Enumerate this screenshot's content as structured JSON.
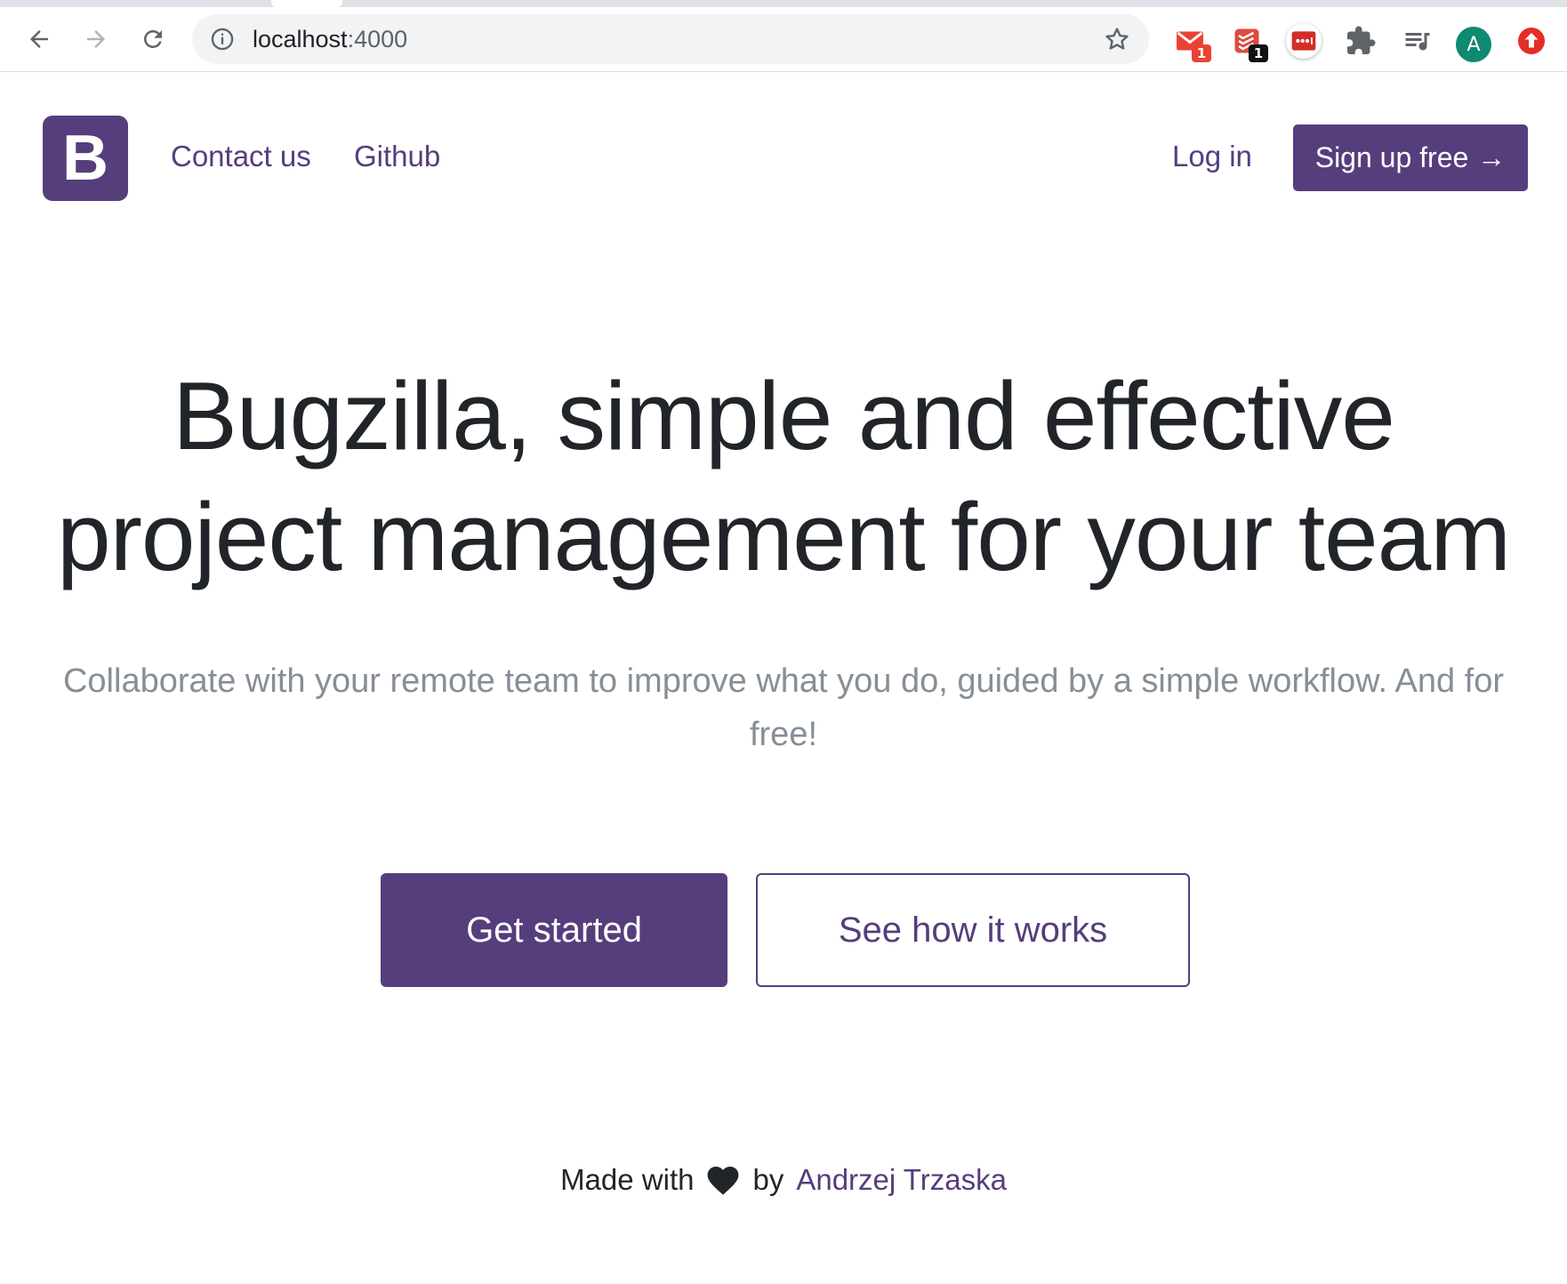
{
  "browser": {
    "url_host": "localhost",
    "url_port": ":4000",
    "extensions": [
      {
        "name": "gmail-extension-icon",
        "badge": "1"
      },
      {
        "name": "todoist-extension-icon",
        "badge": "1"
      },
      {
        "name": "lastpass-extension-icon"
      },
      {
        "name": "extensions-puzzle-icon"
      },
      {
        "name": "media-queue-icon"
      }
    ],
    "profile_initial": "A",
    "colors": {
      "toolbar_bg": "#ffffff",
      "omnibox_bg": "#f1f3f4",
      "gmail_red": "#ea4335",
      "todoist_red": "#db4c3f",
      "lastpass_red": "#d32d27",
      "avatar_green": "#0f8a72",
      "update_red": "#e52d27"
    }
  },
  "navbar": {
    "logo_letter": "B",
    "links": [
      "Contact us",
      "Github"
    ],
    "login": "Log in",
    "signup": "Sign up free",
    "signup_arrow": "→"
  },
  "hero": {
    "title_line1": "Bugzilla, simple and effective",
    "title_line2": "project management for your team",
    "subtitle": "Collaborate with your remote team to improve what you do, guided by a simple workflow. And for free!",
    "primary_button": "Get started",
    "secondary_button": "See how it works"
  },
  "footer": {
    "made_with": "Made with",
    "by": "by",
    "author": "Andrzej Trzaska",
    "heart_icon": "heart-icon"
  },
  "colors": {
    "brand": "#563d7c",
    "text": "#212529",
    "muted": "#868e96"
  }
}
